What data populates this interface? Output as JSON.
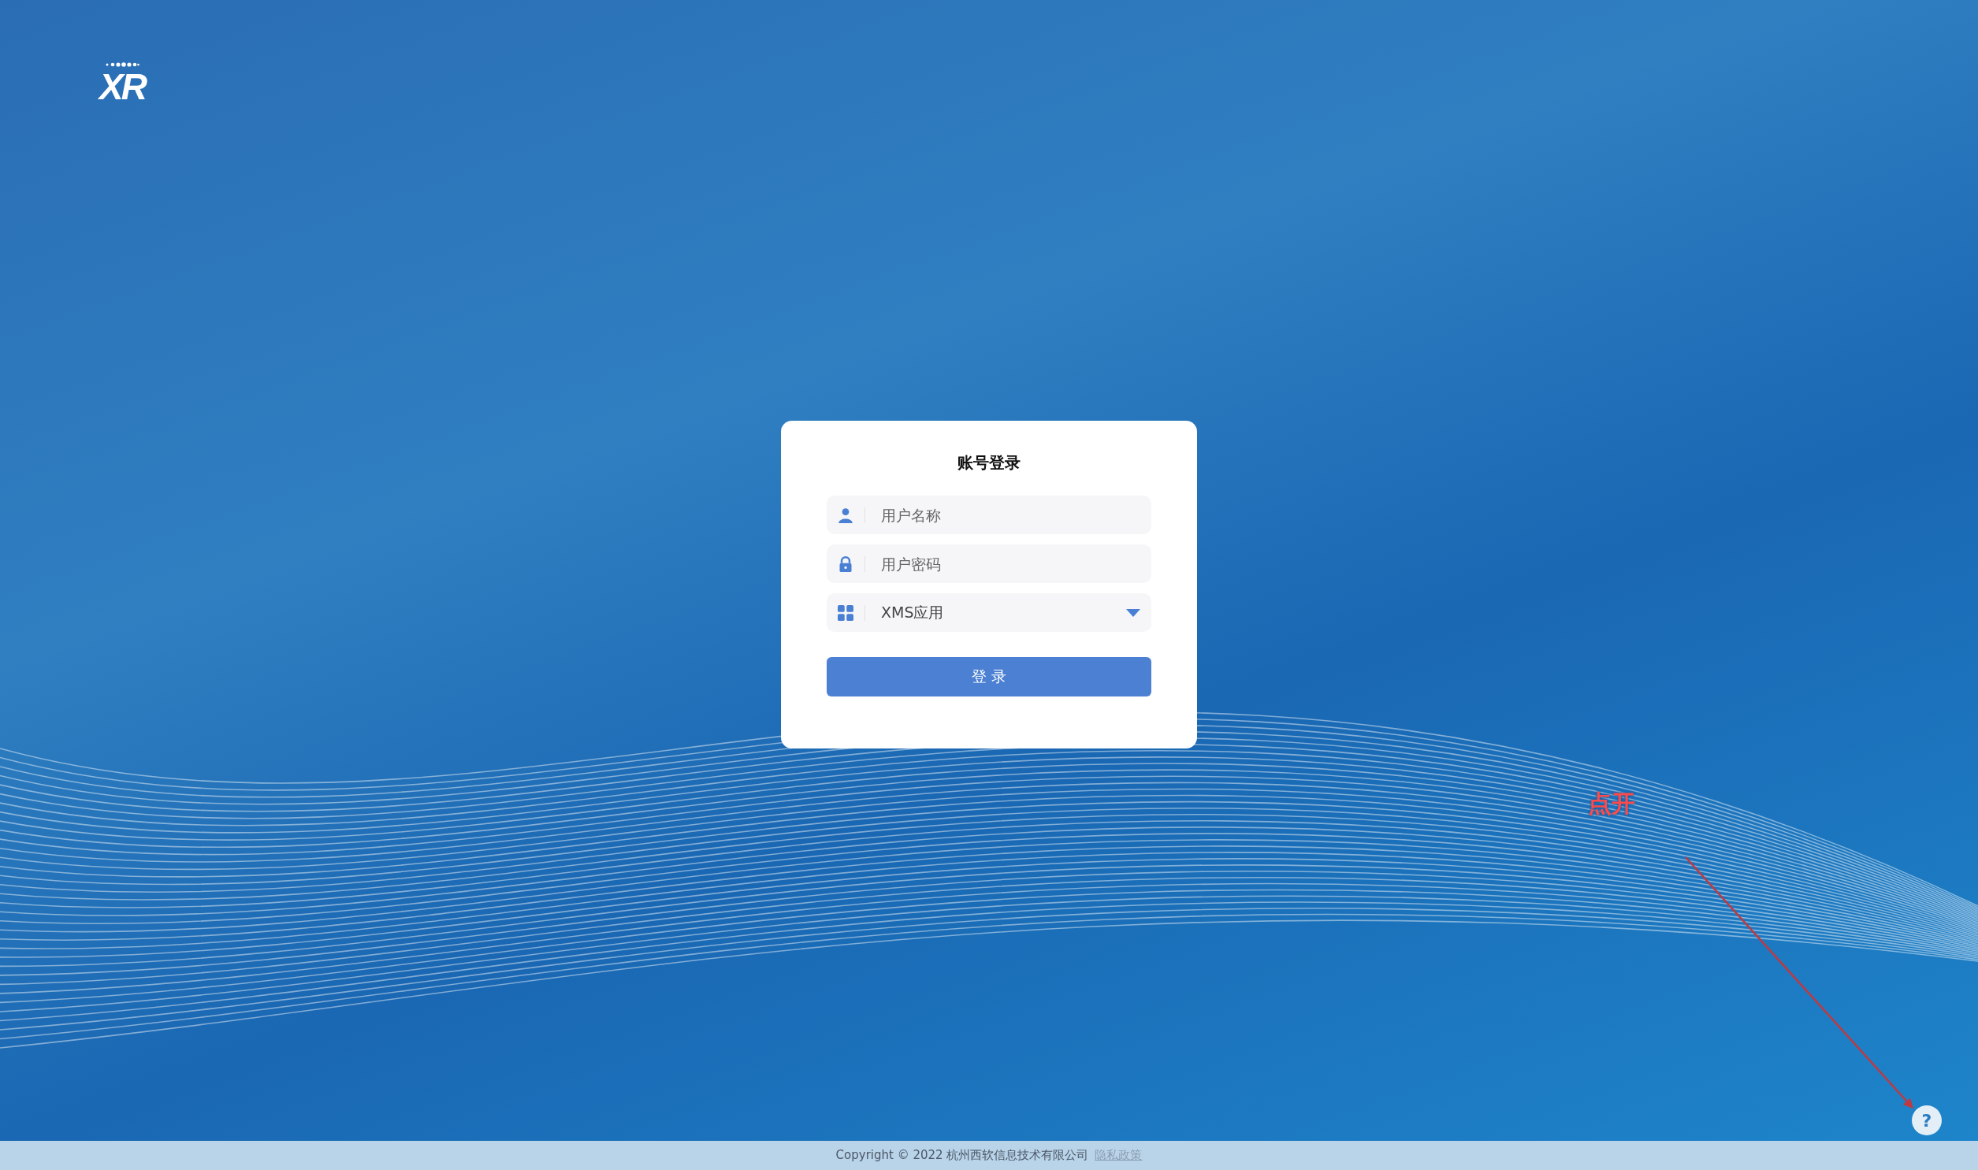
{
  "logo": {
    "text": "XR"
  },
  "login_card": {
    "title": "账号登录",
    "fields": [
      {
        "kind": "text",
        "placeholder": "用户名称"
      },
      {
        "kind": "password",
        "placeholder": "用户密码"
      },
      {
        "kind": "select",
        "value": "XMS应用"
      }
    ],
    "submit_button": "登 录"
  },
  "annotation": {
    "text": "点开"
  },
  "help_button": {
    "label": "?"
  },
  "footer": {
    "copyright": "Copyright © 2022 杭州西软信息技术有限公司",
    "privacy_link": "隐私政策"
  }
}
